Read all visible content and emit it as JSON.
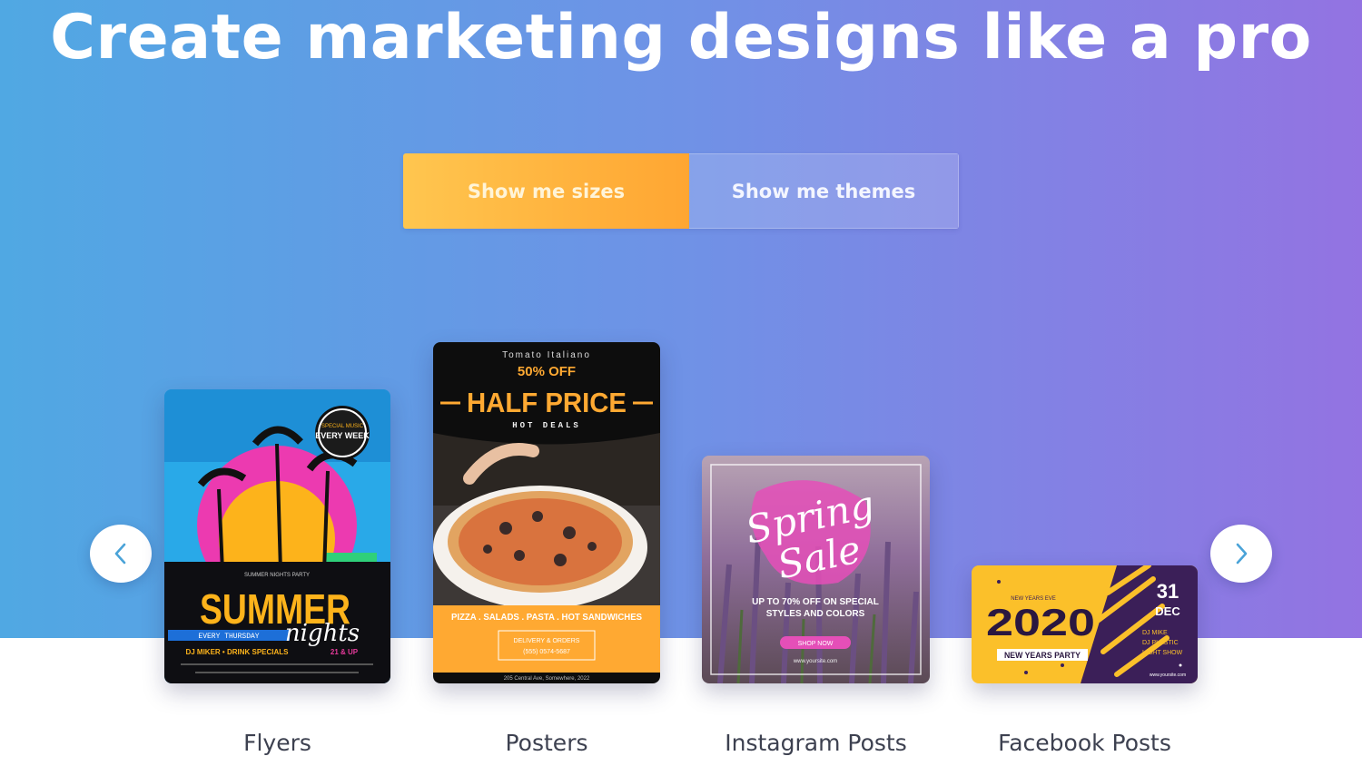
{
  "hero": {
    "title": "Create marketing designs like a pro",
    "background_colors": [
      "#50a8e3",
      "#6f92e6",
      "#9373e2"
    ]
  },
  "toggle": {
    "sizes_label": "Show me sizes",
    "themes_label": "Show me themes",
    "active": "sizes",
    "active_color": "#ffb23d"
  },
  "carousel": {
    "prev_icon": "chevron-left-icon",
    "next_icon": "chevron-right-icon",
    "arrow_color": "#4aa3d8",
    "items": [
      {
        "label": "Flyers",
        "art": {
          "badge_small": "SPECIAL MUSIC",
          "badge": "EVERY WEEK",
          "kicker": "SUMMER NIGHTS PARTY",
          "title": "SUMMER",
          "script": "nights",
          "band": "EVERY THURSDAY",
          "line1": "DJ MIKER • DRINK SPECIALS",
          "age": "21 & UP"
        }
      },
      {
        "label": "Posters",
        "art": {
          "brand": "Tomato Italiano",
          "offer": "50% OFF",
          "title": "HALF PRICE",
          "subtitle": "HOT DEALS",
          "menu": "PIZZA . SALADS . PASTA . HOT SANDWICHES",
          "delivery": "DELIVERY & ORDERS",
          "phone": "(555) 0574-5687",
          "address": "205 Central Ave, Somewhere, 2022"
        }
      },
      {
        "label": "Instagram Posts",
        "art": {
          "script1": "Spring",
          "script2": "Sale",
          "line1": "UP TO 70% OFF ON SPECIAL",
          "line2": "STYLES AND COLORS",
          "cta": "SHOP NOW",
          "url": "www.yoursite.com"
        }
      },
      {
        "label": "Facebook Posts",
        "art": {
          "kicker": "NEW YEARS EVE",
          "year": "2020",
          "banner": "NEW YEARS PARTY",
          "day": "31",
          "month": "DEC",
          "info1": "DJ MIKE",
          "info2": "DJ PLASTIC",
          "info3": "LIGHT SHOW",
          "url": "www.yoursite.com"
        }
      }
    ]
  }
}
